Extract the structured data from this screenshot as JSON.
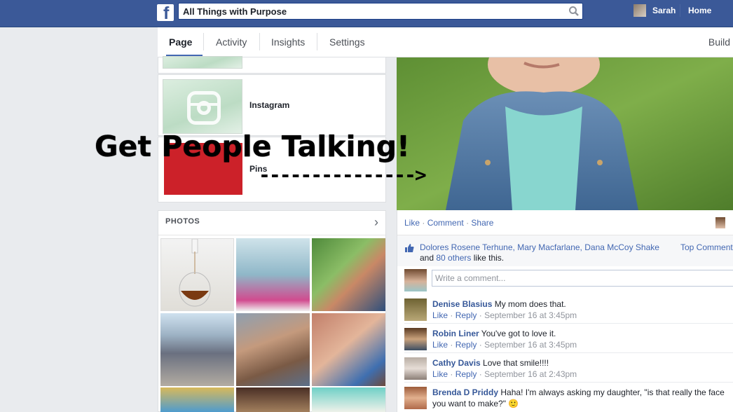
{
  "header": {
    "logo": "f",
    "search_value": "All Things with Purpose",
    "user_name": "Sarah",
    "home_label": "Home"
  },
  "tabs": [
    {
      "label": "Page"
    },
    {
      "label": "Activity"
    },
    {
      "label": "Insights"
    },
    {
      "label": "Settings"
    }
  ],
  "build_label": "Build",
  "apps": {
    "instagram_label": "Instagram",
    "pins_label": "Pins"
  },
  "photos": {
    "title": "PHOTOS",
    "chevron": "›"
  },
  "post": {
    "actions": {
      "like": "Like",
      "comment": "Comment",
      "share": "Share",
      "sep": "·"
    },
    "likers": {
      "names": "Dolores Rosene Terhune, Mary Macfarlane, Dana McCoy Shake",
      "and": "and",
      "others_link": "80 others",
      "suffix": "like this."
    },
    "top_comments": "Top Comment",
    "write_placeholder": "Write a comment..."
  },
  "comments": [
    {
      "author": "Denise Blasius",
      "text": "My mom does that.",
      "like": "Like",
      "reply": "Reply",
      "time": "September 16 at 3:45pm"
    },
    {
      "author": "Robin Liner",
      "text": "You've got to love it.",
      "like": "Like",
      "reply": "Reply",
      "time": "September 16 at 3:45pm"
    },
    {
      "author": "Cathy Davis",
      "text": "Love that smile!!!!",
      "like": "Like",
      "reply": "Reply",
      "time": "September 16 at 2:43pm"
    },
    {
      "author": "Brenda D Priddy",
      "text": "Haha! I'm always asking my daughter, \"is that really the face you want to make?\"",
      "emoji": "🙂"
    }
  ],
  "overlay": {
    "title": "Get People Talking!",
    "arrow": "--------------->"
  },
  "colors": {
    "brand_blue": "#3b5998",
    "link_blue": "#4267b2",
    "pins_red": "#cc2129"
  }
}
